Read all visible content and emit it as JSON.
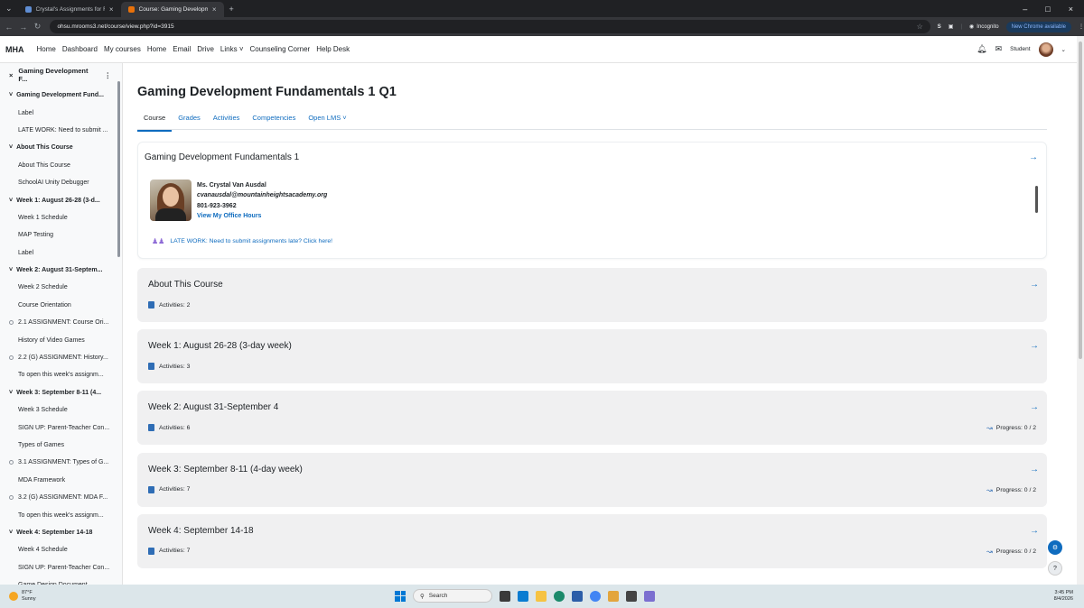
{
  "browser": {
    "tabs": [
      {
        "title": "Crystal's Assignments for Fall 2",
        "active": false
      },
      {
        "title": "Course: Gaming Development F...",
        "active": true
      }
    ],
    "url": "ohsu.mrooms3.net/course/view.php?id=3915",
    "profile": "S",
    "incognito": "Incognito",
    "new_chrome": "New Chrome available"
  },
  "navbar": {
    "brand": "MHA",
    "links": [
      "Home",
      "Dashboard",
      "My courses",
      "Home",
      "Email",
      "Drive",
      "Links ˅",
      "Counseling Corner",
      "Help Desk"
    ],
    "user": "Student",
    "notification_icon": "bell-icon",
    "message_icon": "chat-icon"
  },
  "sidebar": {
    "header": "Gaming Development F...",
    "items": [
      {
        "type": "section",
        "label": "Gaming Development Fund..."
      },
      {
        "type": "activity",
        "label": "Label"
      },
      {
        "type": "activity",
        "label": "LATE WORK: Need to submit ..."
      },
      {
        "type": "section",
        "label": "About This Course"
      },
      {
        "type": "activity",
        "label": "About This Course"
      },
      {
        "type": "activity",
        "label": "SchoolAI Unity Debugger"
      },
      {
        "type": "section",
        "label": "Week 1: August 26-28 (3-d..."
      },
      {
        "type": "activity",
        "label": "Week 1 Schedule"
      },
      {
        "type": "activity",
        "label": "MAP Testing"
      },
      {
        "type": "activity",
        "label": "Label"
      },
      {
        "type": "section",
        "label": "Week 2: August 31-Septem..."
      },
      {
        "type": "activity",
        "label": "Week 2 Schedule"
      },
      {
        "type": "activity",
        "label": "Course Orientation"
      },
      {
        "type": "circle",
        "label": "2.1 ASSIGNMENT: Course Ori..."
      },
      {
        "type": "activity",
        "label": "History of Video Games"
      },
      {
        "type": "circle",
        "label": "2.2 (G) ASSIGNMENT: History..."
      },
      {
        "type": "activity",
        "label": "To open this week's assignm..."
      },
      {
        "type": "section",
        "label": "Week 3: September 8-11 (4..."
      },
      {
        "type": "activity",
        "label": "Week 3 Schedule"
      },
      {
        "type": "activity",
        "label": "SIGN UP: Parent-Teacher Con..."
      },
      {
        "type": "activity",
        "label": "Types of Games"
      },
      {
        "type": "circle",
        "label": "3.1 ASSIGNMENT: Types of G..."
      },
      {
        "type": "activity",
        "label": "MDA Framework"
      },
      {
        "type": "circle",
        "label": "3.2 (G) ASSIGNMENT: MDA F..."
      },
      {
        "type": "activity",
        "label": "To open this week's assignm..."
      },
      {
        "type": "section",
        "label": "Week 4: September 14-18"
      },
      {
        "type": "activity",
        "label": "Week 4 Schedule"
      },
      {
        "type": "activity",
        "label": "SIGN UP: Parent-Teacher Con..."
      },
      {
        "type": "activity",
        "label": "Game Design Document"
      }
    ]
  },
  "course": {
    "title": "Gaming Development Fundamentals 1 Q1",
    "tabs": [
      "Course",
      "Grades",
      "Activities",
      "Competencies",
      "Open LMS ˅"
    ],
    "general": {
      "title": "Gaming Development Fundamentals 1",
      "teacher_name": "Ms. Crystal Van Ausdal",
      "teacher_email": "cvanausdal@mountainheightsacademy.org",
      "teacher_phone": "801-923-3962",
      "office_hours": "View My Office Hours",
      "late_work": "LATE WORK: Need to submit assignments late? Click here!"
    },
    "sections": [
      {
        "title": "About This Course",
        "activities": "Activities: 2",
        "progress": ""
      },
      {
        "title": "Week 1: August 26-28 (3-day week)",
        "activities": "Activities: 3",
        "progress": ""
      },
      {
        "title": "Week 2: August 31-September 4",
        "activities": "Activities: 6",
        "progress": "Progress: 0 / 2"
      },
      {
        "title": "Week 3: September 8-11 (4-day week)",
        "activities": "Activities: 7",
        "progress": "Progress: 0 / 2"
      },
      {
        "title": "Week 4: September 14-18",
        "activities": "Activities: 7",
        "progress": "Progress: 0 / 2"
      }
    ]
  },
  "taskbar": {
    "weather_temp": "87°F",
    "weather_desc": "Sunny",
    "search": "Search",
    "time": "3:45 PM",
    "date": "8/4/2026"
  }
}
